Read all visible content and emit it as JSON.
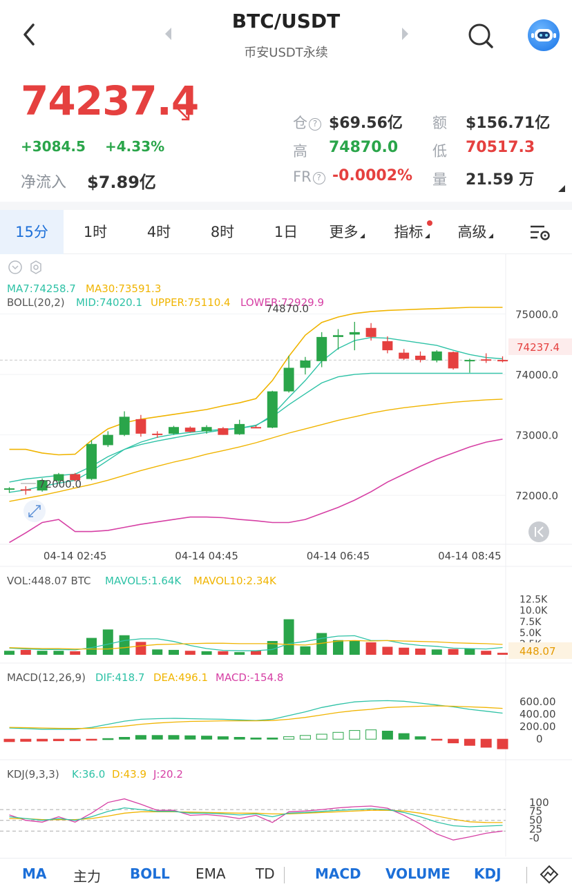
{
  "header": {
    "title": "BTC/USDT",
    "subtitle": "币安USDT永续"
  },
  "ticker": {
    "price": "74237.4",
    "change_abs": "+3084.5",
    "change_pct": "+4.33%",
    "netflow_label": "净流入",
    "netflow_value": "$7.89亿"
  },
  "stats": {
    "oi_label": "仓",
    "oi_value": "$69.56亿",
    "amount_label": "额",
    "amount_value": "$156.71亿",
    "high_label": "高",
    "high_value": "74870.0",
    "low_label": "低",
    "low_value": "70517.3",
    "fr_label": "FR",
    "fr_value": "-0.0002%",
    "vol_label": "量",
    "vol_value": "21.59 万",
    "q_mark": "?"
  },
  "tabs": [
    {
      "label": "15分"
    },
    {
      "label": "1时"
    },
    {
      "label": "4时"
    },
    {
      "label": "8时"
    },
    {
      "label": "1日"
    },
    {
      "label": "更多"
    },
    {
      "label": "指标"
    },
    {
      "label": "高级"
    }
  ],
  "main_legend": {
    "ma7": "MA7:74258.7",
    "ma30": "MA30:73591.3",
    "boll": "BOLL(20,2)",
    "mid": "MID:74020.1",
    "upper": "UPPER:75110.4",
    "lower": "LOWER:72929.9"
  },
  "main_annotations": {
    "high_mark": "74870.0",
    "low_mark": "72000.0",
    "current_price_tag": "74237.4"
  },
  "vol_legend": {
    "vol": "VOL:448.07 BTC",
    "mavol5": "MAVOL5:1.64K",
    "mavol10": "MAVOL10:2.34K",
    "current_tag": "448.07"
  },
  "macd_legend": {
    "name": "MACD(12,26,9)",
    "dif": "DIF:418.7",
    "dea": "DEA:496.1",
    "macd": "MACD:-154.8"
  },
  "kdj_legend": {
    "name": "KDJ(9,3,3)",
    "k": "K:36.0",
    "d": "D:43.9",
    "j": "J:20.2"
  },
  "bottom_bar": {
    "ma": "MA",
    "zhuli": "主力",
    "boll": "BOLL",
    "ema": "EMA",
    "td": "TD",
    "macd": "MACD",
    "volume": "VOLUME",
    "kdj": "KDJ"
  },
  "colors": {
    "up": "#2aa54a",
    "down": "#e5403f",
    "ma7": "#2ec2a6",
    "ma30": "#f0b400",
    "boll_upper": "#f0b400",
    "boll_mid": "#2ec2a6",
    "boll_lower": "#d63fa4",
    "accent": "#1c6fd8"
  },
  "chart_data": [
    {
      "type": "candlestick",
      "title": "",
      "x_ticks": [
        "04-14 02:45",
        "04-14 04:45",
        "04-14 06:45",
        "04-14 08:45"
      ],
      "y_ticks": [
        72000.0,
        73000.0,
        74000.0,
        75000.0
      ],
      "ylim": [
        71190,
        75990
      ],
      "candles": [
        {
          "o": 72105,
          "h": 72135,
          "l": 72040,
          "c": 72115
        },
        {
          "o": 72100,
          "h": 72150,
          "l": 72010,
          "c": 72090
        },
        {
          "o": 72080,
          "h": 72280,
          "l": 72060,
          "c": 72250
        },
        {
          "o": 72240,
          "h": 72370,
          "l": 72200,
          "c": 72350
        },
        {
          "o": 72350,
          "h": 72370,
          "l": 72230,
          "c": 72250
        },
        {
          "o": 72270,
          "h": 72910,
          "l": 72250,
          "c": 72850
        },
        {
          "o": 72830,
          "h": 73060,
          "l": 72800,
          "c": 73000
        },
        {
          "o": 73000,
          "h": 73390,
          "l": 72980,
          "c": 73300
        },
        {
          "o": 73260,
          "h": 73330,
          "l": 72970,
          "c": 73020
        },
        {
          "o": 73020,
          "h": 73060,
          "l": 72950,
          "c": 73000
        },
        {
          "o": 73020,
          "h": 73150,
          "l": 73000,
          "c": 73130
        },
        {
          "o": 73120,
          "h": 73140,
          "l": 73040,
          "c": 73050
        },
        {
          "o": 73060,
          "h": 73160,
          "l": 73020,
          "c": 73130
        },
        {
          "o": 73110,
          "h": 73130,
          "l": 73000,
          "c": 73000
        },
        {
          "o": 73010,
          "h": 73250,
          "l": 73000,
          "c": 73180
        },
        {
          "o": 73130,
          "h": 73160,
          "l": 73110,
          "c": 73120
        },
        {
          "o": 73120,
          "h": 73730,
          "l": 73110,
          "c": 73720
        },
        {
          "o": 73720,
          "h": 74310,
          "l": 73700,
          "c": 74110
        },
        {
          "o": 74110,
          "h": 74290,
          "l": 74000,
          "c": 74230
        },
        {
          "o": 74220,
          "h": 74700,
          "l": 74120,
          "c": 74620
        },
        {
          "o": 74620,
          "h": 74750,
          "l": 74410,
          "c": 74650
        },
        {
          "o": 74660,
          "h": 74870,
          "l": 74400,
          "c": 74700
        },
        {
          "o": 74770,
          "h": 74850,
          "l": 74560,
          "c": 74620
        },
        {
          "o": 74550,
          "h": 74630,
          "l": 74350,
          "c": 74400
        },
        {
          "o": 74360,
          "h": 74420,
          "l": 74240,
          "c": 74260
        },
        {
          "o": 74310,
          "h": 74380,
          "l": 74200,
          "c": 74240
        },
        {
          "o": 74230,
          "h": 74400,
          "l": 74200,
          "c": 74380
        },
        {
          "o": 74370,
          "h": 74380,
          "l": 74080,
          "c": 74100
        },
        {
          "o": 74220,
          "h": 74260,
          "l": 74030,
          "c": 74240
        },
        {
          "o": 74250,
          "h": 74350,
          "l": 74190,
          "c": 74230
        },
        {
          "o": 74240,
          "h": 74300,
          "l": 74200,
          "c": 74237
        }
      ],
      "ma7": [
        72050,
        72090,
        72150,
        72200,
        72250,
        72400,
        72580,
        72760,
        72880,
        72960,
        73010,
        73040,
        73070,
        73090,
        73110,
        73150,
        73330,
        73620,
        73900,
        74220,
        74430,
        74560,
        74610,
        74600,
        74560,
        74520,
        74480,
        74400,
        74330,
        74280,
        74259
      ],
      "ma30": [
        71900,
        71950,
        72000,
        72060,
        72120,
        72180,
        72250,
        72330,
        72410,
        72480,
        72550,
        72610,
        72680,
        72740,
        72800,
        72870,
        72950,
        73030,
        73100,
        73170,
        73240,
        73300,
        73360,
        73410,
        73450,
        73480,
        73510,
        73540,
        73560,
        73580,
        73591
      ],
      "boll_upper": [
        72760,
        72760,
        72700,
        72670,
        72680,
        72910,
        73100,
        73200,
        73260,
        73300,
        73340,
        73380,
        73420,
        73480,
        73530,
        73600,
        73900,
        74300,
        74650,
        74860,
        74950,
        75010,
        75040,
        75060,
        75070,
        75080,
        75090,
        75100,
        75110,
        75110,
        75110
      ],
      "boll_mid": [
        72220,
        72270,
        72300,
        72330,
        72350,
        72480,
        72640,
        72760,
        72840,
        72900,
        72950,
        73000,
        73040,
        73080,
        73110,
        73160,
        73300,
        73500,
        73680,
        73860,
        73960,
        74000,
        74020,
        74020,
        74020,
        74020,
        74020,
        74020,
        74020,
        74020,
        74020
      ],
      "boll_lower": [
        71220,
        71380,
        71550,
        71600,
        71400,
        71400,
        71420,
        71470,
        71520,
        71560,
        71600,
        71640,
        71640,
        71630,
        71600,
        71580,
        71550,
        71550,
        71600,
        71700,
        71800,
        71920,
        72060,
        72220,
        72350,
        72480,
        72600,
        72700,
        72800,
        72880,
        72930
      ]
    },
    {
      "type": "bar",
      "title": "VOL",
      "y_ticks": [
        2500,
        5000,
        7500,
        10000,
        12500
      ],
      "ylim": [
        0,
        14000
      ],
      "values": [
        900,
        1100,
        900,
        900,
        800,
        3800,
        5700,
        4400,
        2900,
        1200,
        1100,
        900,
        800,
        800,
        600,
        900,
        3100,
        8000,
        1900,
        4900,
        3300,
        3200,
        2800,
        1800,
        1600,
        1400,
        1200,
        1300,
        1400,
        900,
        448.07
      ],
      "up": [
        true,
        false,
        true,
        true,
        false,
        true,
        true,
        true,
        false,
        true,
        true,
        false,
        true,
        false,
        true,
        false,
        true,
        true,
        true,
        true,
        true,
        true,
        false,
        false,
        false,
        false,
        true,
        false,
        true,
        false,
        false
      ],
      "mavol5": [
        1500,
        1300,
        1200,
        1200,
        1100,
        1600,
        2400,
        3200,
        3600,
        3600,
        3000,
        2100,
        1400,
        1000,
        900,
        900,
        1200,
        2500,
        3000,
        3700,
        4200,
        4300,
        3200,
        3200,
        2500,
        2100,
        1900,
        1500,
        1400,
        1300,
        1640
      ],
      "mavol10": [
        1600,
        1500,
        1400,
        1400,
        1300,
        1300,
        1300,
        1600,
        2000,
        2300,
        2400,
        2500,
        2600,
        2600,
        2500,
        2500,
        2500,
        2300,
        2200,
        2600,
        3100,
        3200,
        3100,
        3200,
        3100,
        3000,
        2900,
        2700,
        2600,
        2500,
        2340
      ]
    },
    {
      "type": "bar",
      "title": "MACD",
      "y_ticks": [
        0,
        200.0,
        400.0,
        600.0
      ],
      "ylim": [
        -220,
        780
      ],
      "hist": [
        -40,
        -35,
        -30,
        -25,
        -25,
        -10,
        10,
        30,
        60,
        60,
        60,
        55,
        50,
        40,
        30,
        20,
        20,
        40,
        60,
        80,
        110,
        140,
        150,
        130,
        90,
        40,
        -10,
        -60,
        -100,
        -130,
        -154.8
      ],
      "dif": [
        180,
        170,
        160,
        160,
        160,
        190,
        240,
        290,
        320,
        330,
        335,
        330,
        325,
        320,
        310,
        300,
        320,
        380,
        440,
        510,
        560,
        600,
        615,
        620,
        610,
        580,
        550,
        520,
        480,
        450,
        418.7
      ],
      "dea": [
        190,
        185,
        180,
        175,
        172,
        175,
        190,
        210,
        240,
        260,
        275,
        285,
        290,
        295,
        295,
        295,
        300,
        320,
        350,
        390,
        430,
        460,
        480,
        510,
        520,
        530,
        535,
        530,
        520,
        510,
        496.1
      ]
    },
    {
      "type": "line",
      "title": "KDJ",
      "y_ticks": [
        0,
        25,
        50,
        75,
        100
      ],
      "ylim": [
        -20,
        115
      ],
      "k": [
        60,
        55,
        50,
        55,
        50,
        60,
        75,
        85,
        80,
        75,
        75,
        70,
        70,
        68,
        65,
        68,
        60,
        70,
        72,
        75,
        78,
        80,
        82,
        80,
        72,
        60,
        45,
        35,
        32,
        34,
        36.0
      ],
      "d": [
        55,
        55,
        52,
        52,
        52,
        55,
        62,
        70,
        74,
        74,
        74,
        73,
        72,
        71,
        70,
        70,
        68,
        68,
        70,
        72,
        74,
        76,
        78,
        78,
        76,
        70,
        62,
        53,
        46,
        44,
        43.9
      ],
      "j": [
        65,
        50,
        45,
        60,
        45,
        70,
        100,
        110,
        95,
        78,
        78,
        64,
        66,
        62,
        55,
        64,
        44,
        74,
        76,
        80,
        85,
        88,
        90,
        84,
        64,
        40,
        12,
        -5,
        4,
        14,
        20.2
      ]
    }
  ]
}
